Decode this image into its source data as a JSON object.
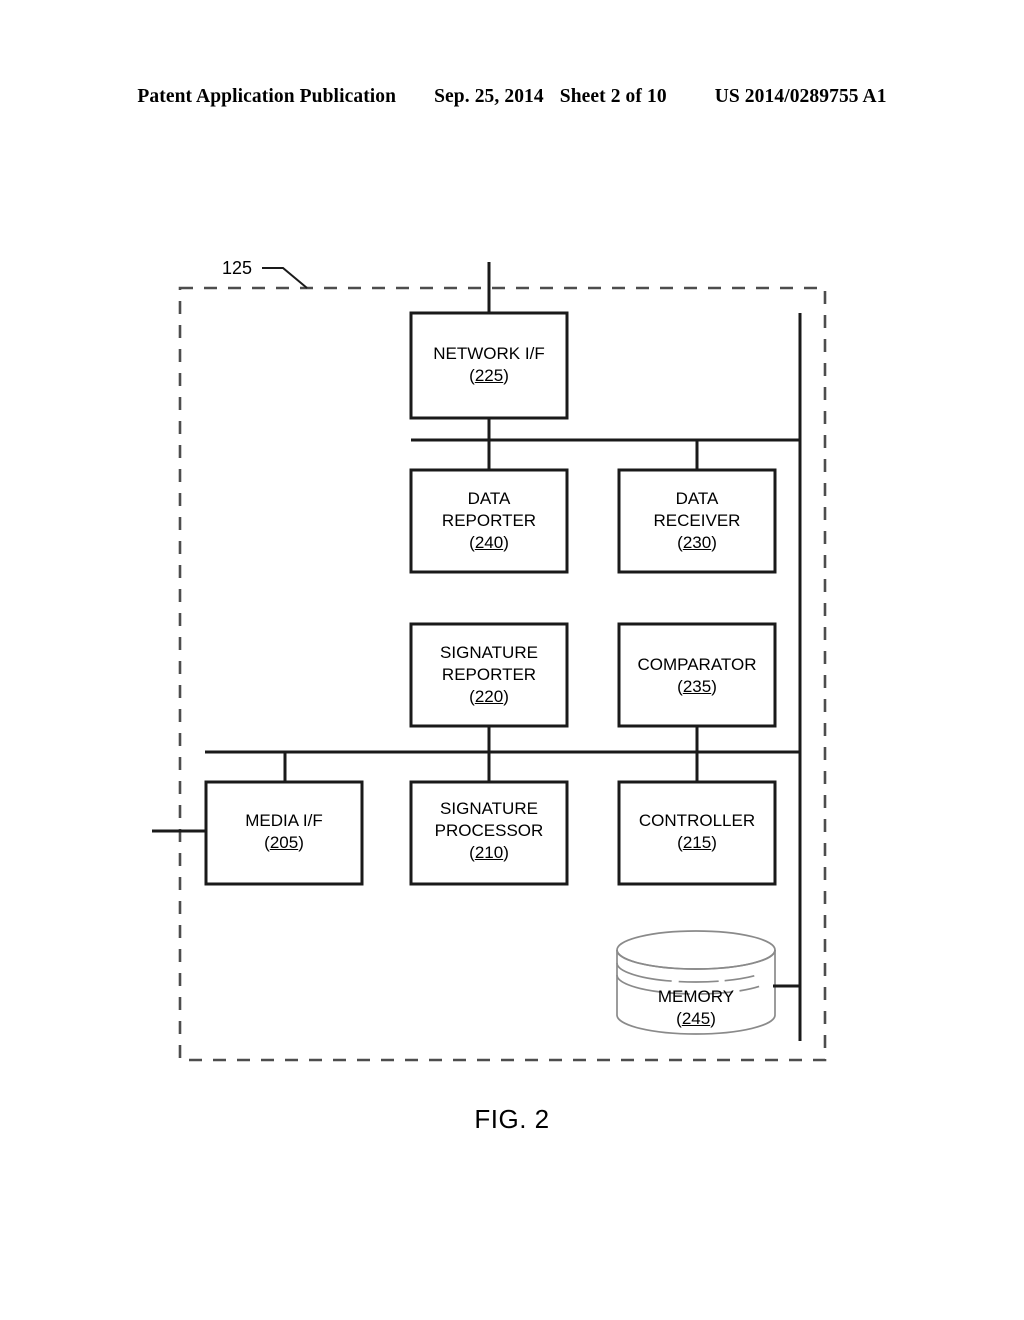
{
  "header": {
    "publication": "Patent Application Publication",
    "date": "Sep. 25, 2014",
    "sheet": "Sheet 2 of 10",
    "patent_number": "US 2014/0289755 A1"
  },
  "figure": {
    "caption": "FIG. 2",
    "enclosure_ref": "125",
    "blocks": [
      {
        "id": "network-if",
        "title_line1": "NETWORK I/F",
        "title_line2": "",
        "ref": "225"
      },
      {
        "id": "data-reporter",
        "title_line1": "DATA",
        "title_line2": "REPORTER",
        "ref": "240"
      },
      {
        "id": "data-receiver",
        "title_line1": "DATA",
        "title_line2": "RECEIVER",
        "ref": "230"
      },
      {
        "id": "signature-reporter",
        "title_line1": "SIGNATURE",
        "title_line2": "REPORTER",
        "ref": "220"
      },
      {
        "id": "comparator",
        "title_line1": "COMPARATOR",
        "title_line2": "",
        "ref": "235"
      },
      {
        "id": "media-if",
        "title_line1": "MEDIA I/F",
        "title_line2": "",
        "ref": "205"
      },
      {
        "id": "signature-processor",
        "title_line1": "SIGNATURE",
        "title_line2": "PROCESSOR",
        "ref": "210"
      },
      {
        "id": "controller",
        "title_line1": "CONTROLLER",
        "title_line2": "",
        "ref": "215"
      },
      {
        "id": "memory",
        "title_line1": "MEMORY",
        "title_line2": "",
        "ref": "245"
      }
    ],
    "colors": {
      "line": "#1a1a1a",
      "dashed_boundary": "#4d4d4d",
      "cylinder_stroke": "#8a8a8a",
      "text": "#000000",
      "background": "#ffffff"
    }
  }
}
